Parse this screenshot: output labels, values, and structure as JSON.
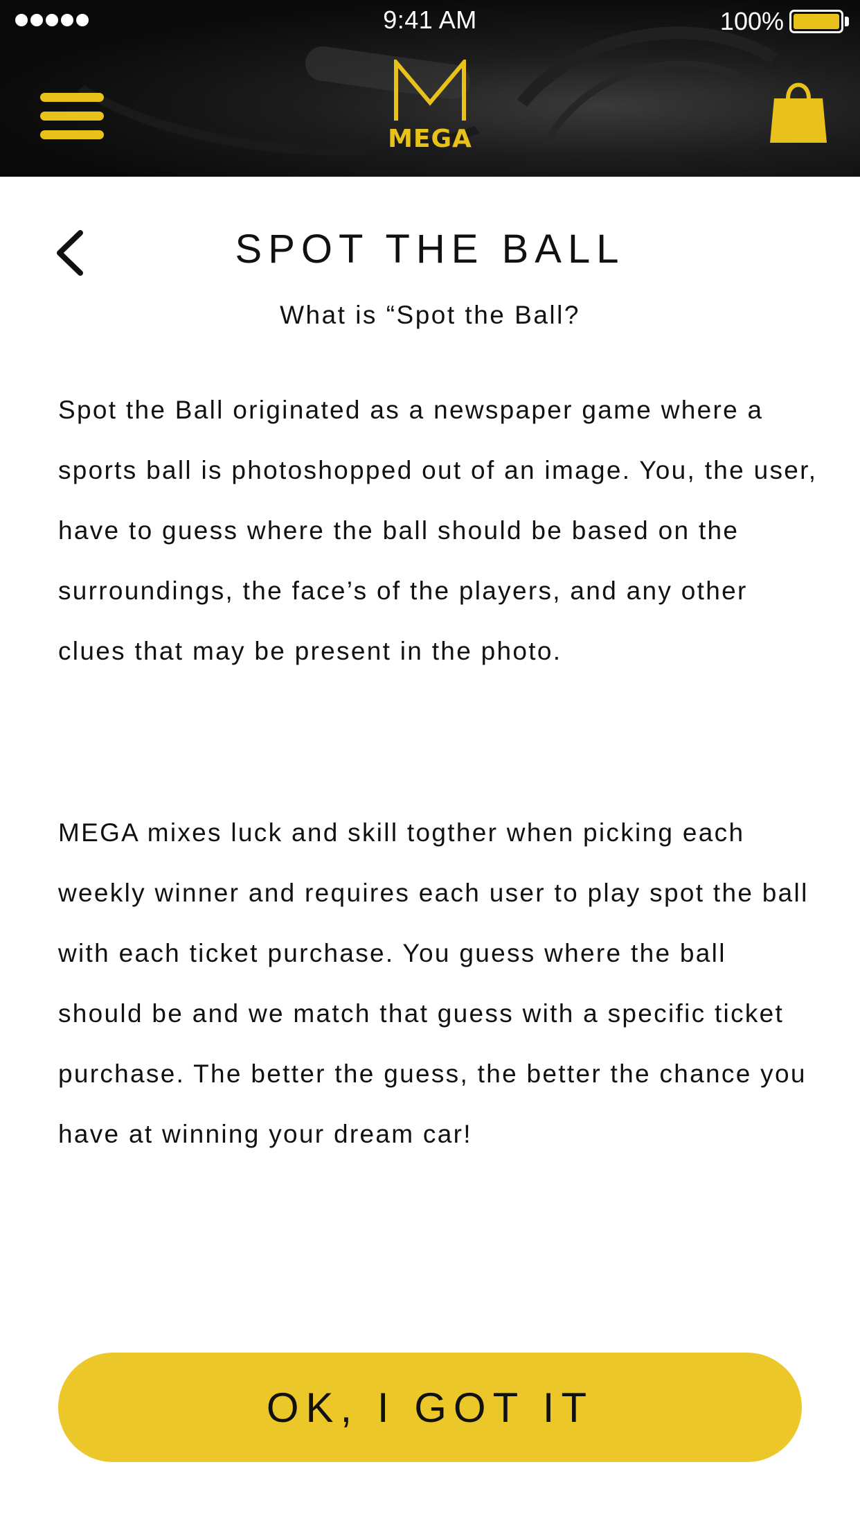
{
  "status_bar": {
    "time": "9:41 AM",
    "battery_percent": "100%",
    "battery_level": 1.0,
    "signal_bars": 5
  },
  "header": {
    "logo_letter": "M",
    "logo_text": "MEGA",
    "menu_icon": "hamburger-menu-icon",
    "cart_icon": "shopping-bag-icon"
  },
  "page": {
    "back_icon": "chevron-left-icon",
    "title": "SPOT THE BALL",
    "subtitle": "What is “Spot the Ball?",
    "paragraphs": [
      "Spot the Ball originated as a newspaper game where a sports ball is photoshopped out of an image. You, the user, have to guess where the ball should be based on the surroundings, the face’s of the players, and any other clues that may be present in the photo.",
      "MEGA mixes luck and skill togther when picking each weekly winner and requires each user to play spot the ball with each ticket purchase. You guess where the ball should be and we match that guess with a specific ticket purchase. The better the guess, the better the chance you have at winning your dream car!"
    ],
    "ok_button_label": "OK, I GOT IT"
  },
  "colors": {
    "accent": "#EBC72A",
    "header_background": "#111111",
    "text": "#111111",
    "background": "#FFFFFF"
  }
}
